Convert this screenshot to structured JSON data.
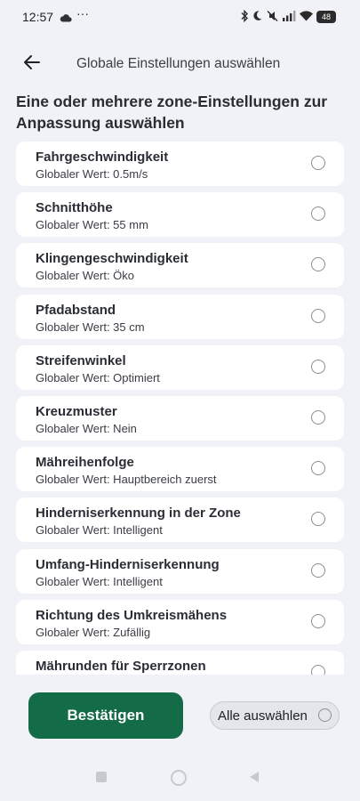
{
  "status_bar": {
    "time": "12:57",
    "dots": "···",
    "battery": "48",
    "icons": [
      "cloud-icon",
      "bluetooth-icon",
      "moon-icon",
      "mute-icon",
      "signal-icon",
      "wifi-icon",
      "battery-icon"
    ]
  },
  "header": {
    "title": "Globale Einstellungen auswählen",
    "back_icon": "arrow-left-icon"
  },
  "section_heading": "Eine oder mehrere zone-Einstellungen zur Anpassung auswählen",
  "settings": [
    {
      "title": "Fahrgeschwindigkeit",
      "subtitle": "Globaler Wert: 0.5m/s",
      "selected": false
    },
    {
      "title": "Schnitthöhe",
      "subtitle": "Globaler Wert: 55 mm",
      "selected": false
    },
    {
      "title": "Klingengeschwindigkeit",
      "subtitle": "Globaler Wert: Öko",
      "selected": false
    },
    {
      "title": "Pfadabstand",
      "subtitle": "Globaler Wert: 35 cm",
      "selected": false
    },
    {
      "title": "Streifenwinkel",
      "subtitle": "Globaler Wert: Optimiert",
      "selected": false
    },
    {
      "title": "Kreuzmuster",
      "subtitle": "Globaler Wert: Nein",
      "selected": false
    },
    {
      "title": "Mähreihenfolge",
      "subtitle": "Globaler Wert: Hauptbereich zuerst",
      "selected": false
    },
    {
      "title": "Hinderniserkennung in der Zone",
      "subtitle": "Globaler Wert: Intelligent",
      "selected": false
    },
    {
      "title": "Umfang-Hinderniserkennung",
      "subtitle": "Globaler Wert: Intelligent",
      "selected": false
    },
    {
      "title": "Richtung des Umkreismähens",
      "subtitle": "Globaler Wert: Zufällig",
      "selected": false
    },
    {
      "title": "Mährunden für Sperrzonen",
      "subtitle": "",
      "selected": false
    }
  ],
  "footer": {
    "confirm_label": "Bestätigen",
    "select_all_label": "Alle auswählen",
    "select_all_checked": false
  },
  "colors": {
    "background": "#f1f2f7",
    "primary_button": "#136b47",
    "card": "#ffffff"
  }
}
